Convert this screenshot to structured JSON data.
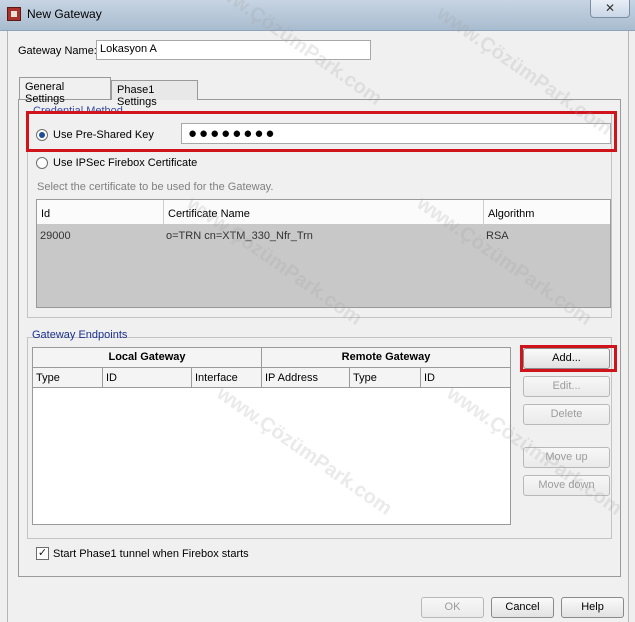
{
  "window": {
    "title": "New Gateway",
    "close_label": "✕"
  },
  "gateway_name": {
    "label": "Gateway Name:",
    "value": "Lokasyon A"
  },
  "tabs": [
    {
      "label": "General Settings",
      "active": true
    },
    {
      "label": "Phase1 Settings",
      "active": false
    }
  ],
  "credential": {
    "title": "Credential Method",
    "psk_label": "Use Pre-Shared Key",
    "psk_value": "●●●●●●●●",
    "psk_selected": true,
    "cert_label": "Use IPSec Firebox Certificate",
    "cert_hint": "Select the certificate to be used for the Gateway.",
    "table": {
      "columns": [
        "Id",
        "Certificate Name",
        "Algorithm"
      ],
      "rows": [
        {
          "id": "29000",
          "name": "o=TRN cn=XTM_330_Nfr_Trn",
          "algorithm": "RSA"
        }
      ]
    }
  },
  "endpoints": {
    "title": "Gateway Endpoints",
    "local_header": "Local Gateway",
    "remote_header": "Remote Gateway",
    "columns": [
      "Type",
      "ID",
      "Interface",
      "IP Address",
      "Type",
      "ID"
    ],
    "buttons": {
      "add": "Add...",
      "edit": "Edit...",
      "delete": "Delete",
      "move_up": "Move up",
      "move_down": "Move down"
    }
  },
  "start_phase1": {
    "label": "Start Phase1 tunnel when Firebox starts",
    "checked": true,
    "mark": "✓"
  },
  "footer": {
    "ok": "OK",
    "cancel": "Cancel",
    "help": "Help"
  },
  "watermark": "www.ÇözümPark.com",
  "colors": {
    "highlight": "#d1141b",
    "group_title": "#1b2f8f",
    "radio_dot": "#1f4c9a"
  }
}
